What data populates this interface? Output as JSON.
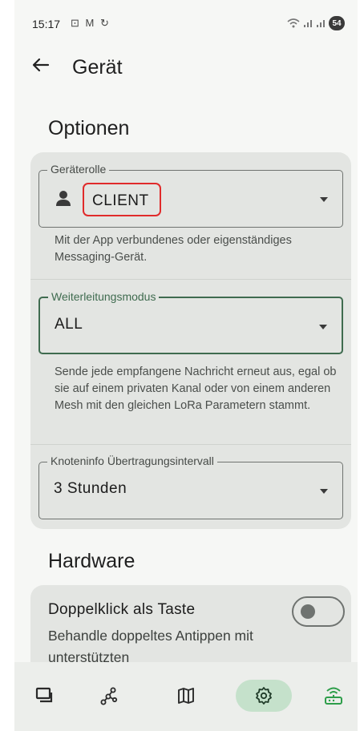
{
  "status_bar": {
    "time": "15:17",
    "left_icons": "⊡ M ↻",
    "battery": "54"
  },
  "header": {
    "title": "Gerät"
  },
  "sections": {
    "options_title": "Optionen",
    "hardware_title": "Hardware"
  },
  "device_role": {
    "label": "Geräterolle",
    "value": "CLIENT",
    "helper": "Mit der App verbundenes oder eigenständiges Messaging-Gerät."
  },
  "rebroadcast": {
    "label": "Weiterleitungsmodus",
    "value": "ALL",
    "helper": "Sende jede empfangene Nachricht erneut aus, egal ob sie auf einem privaten Kanal oder von einem anderen Mesh mit den gleichen LoRa Parametern stammt."
  },
  "nodeinfo": {
    "label": "Knoteninfo Übertragungsintervall",
    "value": "3 Stunden"
  },
  "hardware": {
    "double_tap_title": "Doppelklick als Taste",
    "double_tap_sub": "Behandle doppeltes Antippen mit unterstützten",
    "double_tap_enabled": false
  },
  "bottom_nav": {
    "items": [
      "messages-icon",
      "nodes-icon",
      "map-icon",
      "settings-icon",
      "connection-icon"
    ],
    "selected": "settings-icon",
    "accent": "#c5e1cb",
    "connected_color": "#2e9e4a"
  },
  "colors": {
    "highlight_border": "#e02b2b",
    "active_field": "#3f6b4f"
  }
}
